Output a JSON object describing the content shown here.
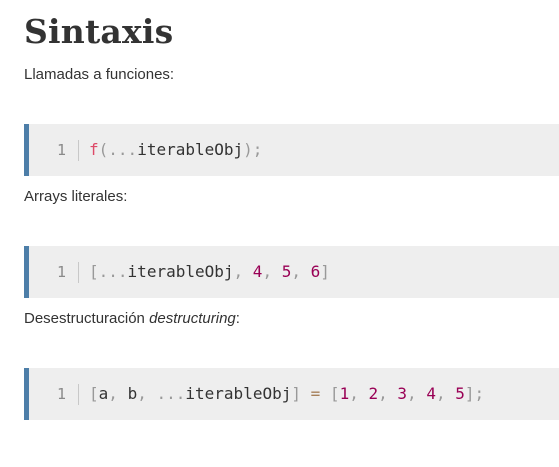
{
  "heading": "Sintaxis",
  "sections": [
    {
      "intro": "Llamadas a funciones:",
      "line_number": "1",
      "tokens": [
        {
          "text": "f",
          "kind": "fn"
        },
        {
          "text": "(",
          "kind": "punc"
        },
        {
          "text": "...",
          "kind": "punc"
        },
        {
          "text": "iterableObj",
          "kind": "plain"
        },
        {
          "text": ")",
          "kind": "punc"
        },
        {
          "text": ";",
          "kind": "punc"
        }
      ]
    },
    {
      "intro": "Arrays literales:",
      "line_number": "1",
      "tokens": [
        {
          "text": "[",
          "kind": "punc"
        },
        {
          "text": "...",
          "kind": "punc"
        },
        {
          "text": "iterableObj",
          "kind": "plain"
        },
        {
          "text": ",",
          "kind": "punc"
        },
        {
          "text": " ",
          "kind": "plain"
        },
        {
          "text": "4",
          "kind": "num"
        },
        {
          "text": ",",
          "kind": "punc"
        },
        {
          "text": " ",
          "kind": "plain"
        },
        {
          "text": "5",
          "kind": "num"
        },
        {
          "text": ",",
          "kind": "punc"
        },
        {
          "text": " ",
          "kind": "plain"
        },
        {
          "text": "6",
          "kind": "num"
        },
        {
          "text": "]",
          "kind": "punc"
        }
      ]
    },
    {
      "intro_plain": "Desestructuración ",
      "intro_em": "destructuring",
      "intro_tail": ":",
      "line_number": "1",
      "tokens": [
        {
          "text": "[",
          "kind": "punc"
        },
        {
          "text": "a",
          "kind": "plain"
        },
        {
          "text": ",",
          "kind": "punc"
        },
        {
          "text": " ",
          "kind": "plain"
        },
        {
          "text": "b",
          "kind": "plain"
        },
        {
          "text": ",",
          "kind": "punc"
        },
        {
          "text": " ",
          "kind": "plain"
        },
        {
          "text": "...",
          "kind": "punc"
        },
        {
          "text": "iterableObj",
          "kind": "plain"
        },
        {
          "text": "]",
          "kind": "punc"
        },
        {
          "text": " ",
          "kind": "plain"
        },
        {
          "text": "=",
          "kind": "op"
        },
        {
          "text": " ",
          "kind": "plain"
        },
        {
          "text": "[",
          "kind": "punc"
        },
        {
          "text": "1",
          "kind": "num"
        },
        {
          "text": ",",
          "kind": "punc"
        },
        {
          "text": " ",
          "kind": "plain"
        },
        {
          "text": "2",
          "kind": "num"
        },
        {
          "text": ",",
          "kind": "punc"
        },
        {
          "text": " ",
          "kind": "plain"
        },
        {
          "text": "3",
          "kind": "num"
        },
        {
          "text": ",",
          "kind": "punc"
        },
        {
          "text": " ",
          "kind": "plain"
        },
        {
          "text": "4",
          "kind": "num"
        },
        {
          "text": ",",
          "kind": "punc"
        },
        {
          "text": " ",
          "kind": "plain"
        },
        {
          "text": "5",
          "kind": "num"
        },
        {
          "text": "]",
          "kind": "punc"
        },
        {
          "text": ";",
          "kind": "punc"
        }
      ]
    }
  ],
  "colors": {
    "accent_border": "#4d7ea8",
    "code_background": "#eeeeee",
    "function": "#dd4a68",
    "number": "#990055",
    "punctuation": "#999999",
    "operator": "#a67f59"
  }
}
